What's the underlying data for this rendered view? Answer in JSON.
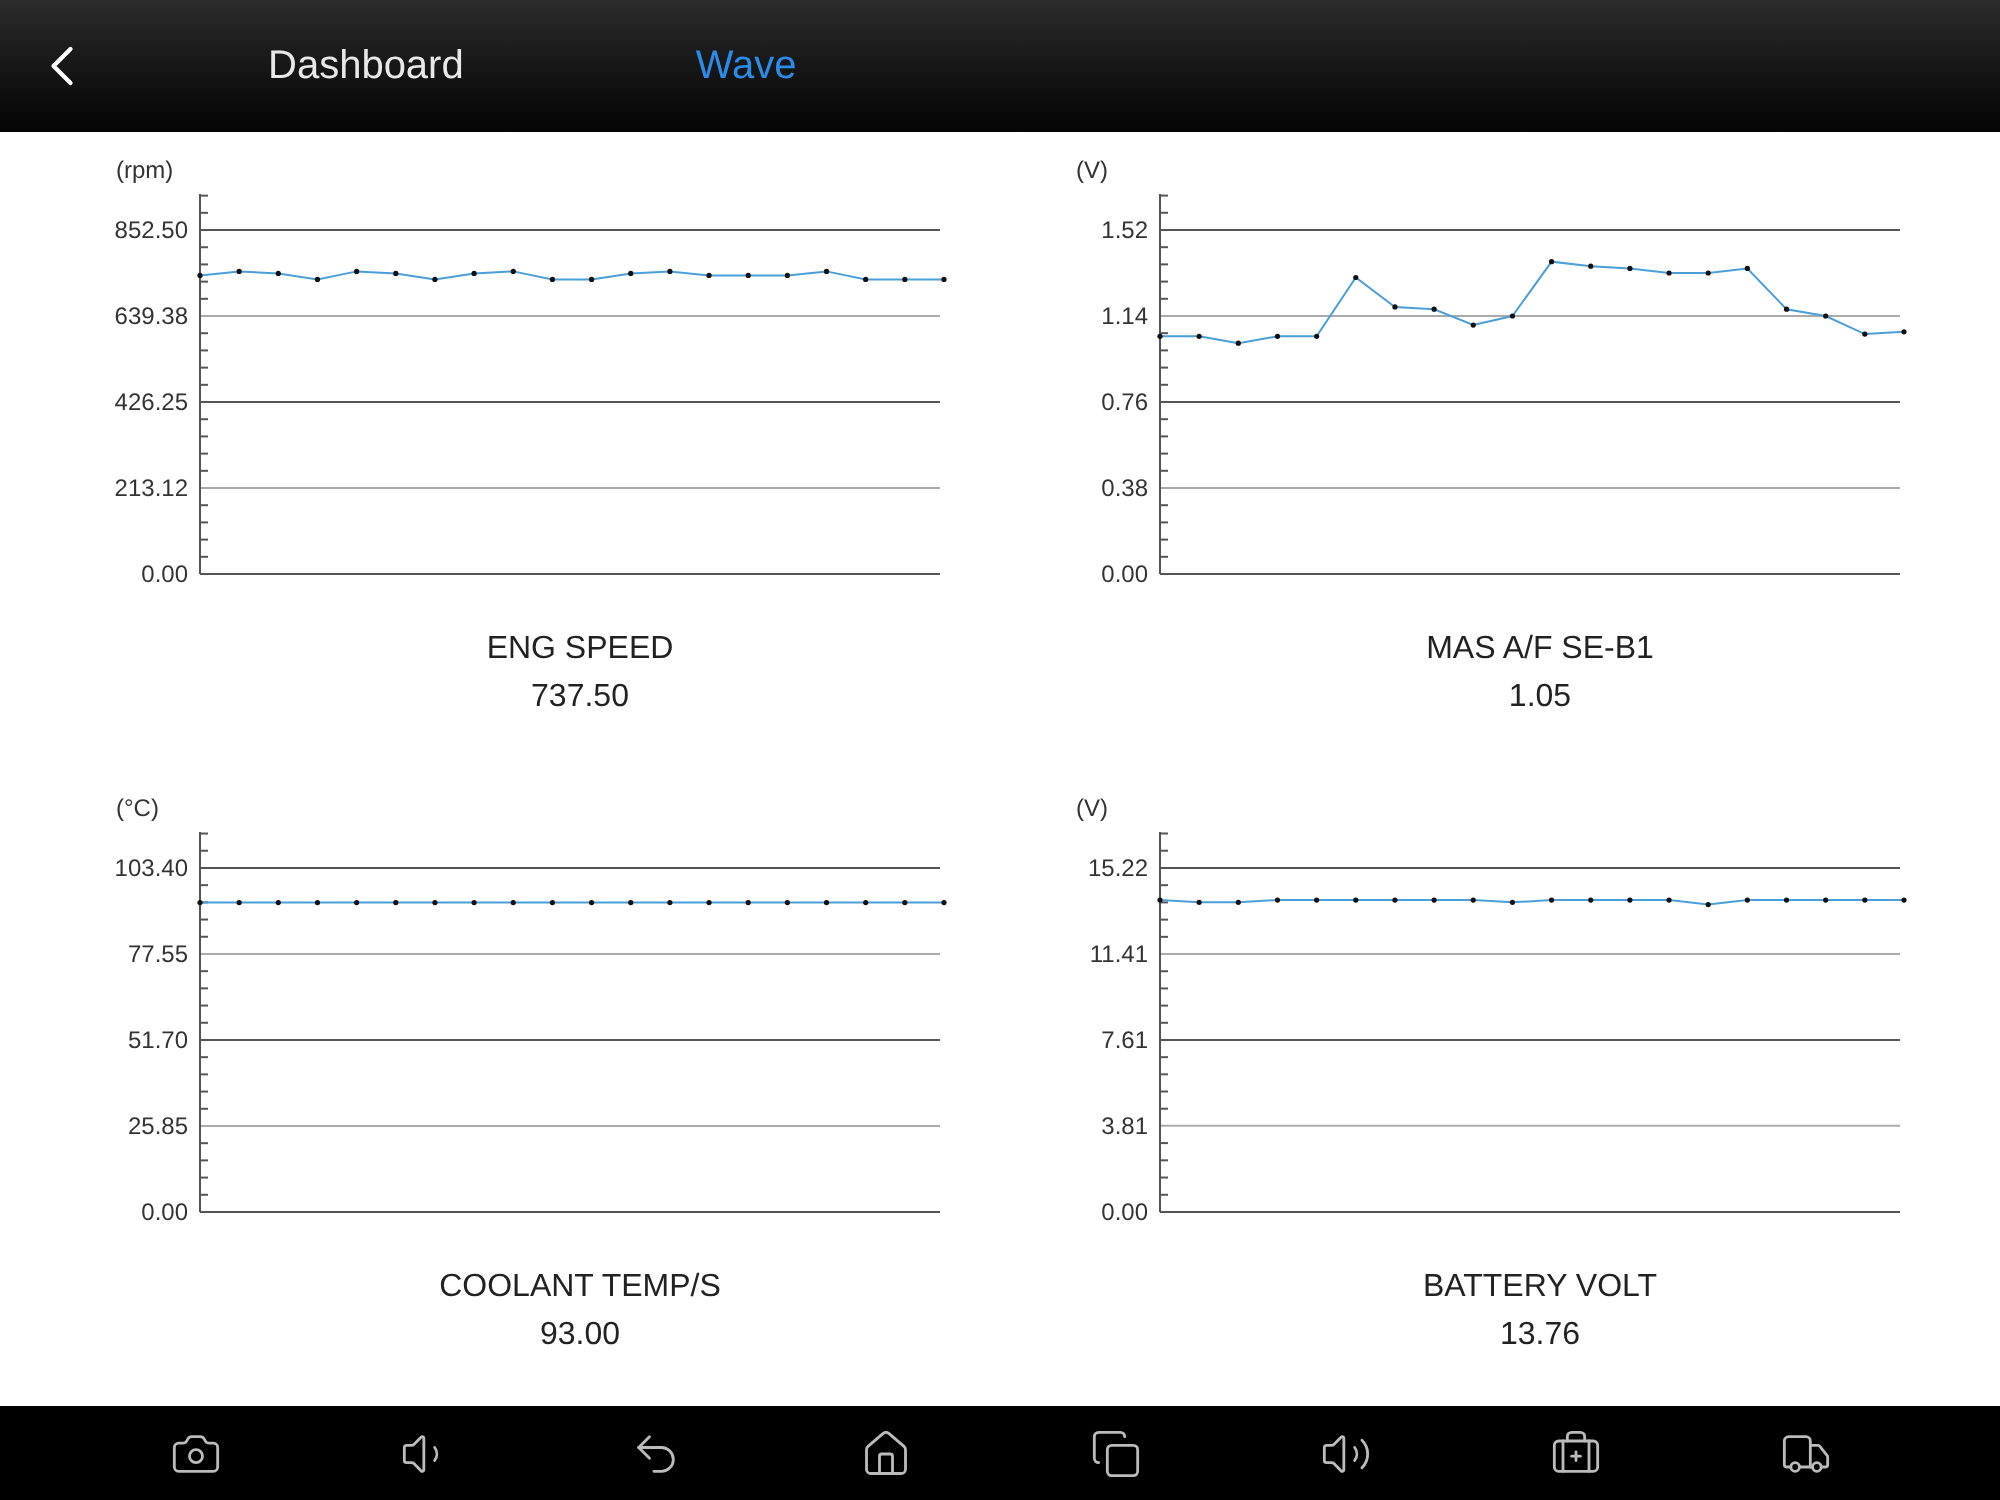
{
  "header": {
    "tabs": [
      {
        "label": "Dashboard",
        "selected": false
      },
      {
        "label": "Wave",
        "selected": true
      }
    ]
  },
  "panels": [
    {
      "name": "ENG SPEED",
      "value": "737.50",
      "chart_data": {
        "type": "line",
        "ylabel": "(rpm)",
        "grid": true,
        "ylim": [
          0,
          941.8
        ],
        "yticks": [
          {
            "value": 0,
            "label": "0.00"
          },
          {
            "value": 213.12,
            "label": "213.12"
          },
          {
            "value": 426.25,
            "label": "426.25"
          },
          {
            "value": 639.38,
            "label": "639.38"
          },
          {
            "value": 852.5,
            "label": "852.50"
          }
        ],
        "series": [
          {
            "color": "#4a9fd8",
            "values": [
              740,
              750,
              745,
              730,
              750,
              745,
              730,
              745,
              750,
              730,
              730,
              745,
              750,
              740,
              740,
              740,
              750,
              730,
              730,
              730
            ]
          }
        ]
      }
    },
    {
      "name": "MAS A/F SE-B1",
      "value": "1.05",
      "chart_data": {
        "type": "line",
        "ylabel": "(V)",
        "grid": true,
        "ylim": [
          0,
          1.679
        ],
        "yticks": [
          {
            "value": 0,
            "label": "0.00"
          },
          {
            "value": 0.38,
            "label": "0.38"
          },
          {
            "value": 0.76,
            "label": "0.76"
          },
          {
            "value": 1.14,
            "label": "1.14"
          },
          {
            "value": 1.52,
            "label": "1.52"
          }
        ],
        "series": [
          {
            "color": "#4a9fd8",
            "values": [
              1.05,
              1.05,
              1.02,
              1.05,
              1.05,
              1.31,
              1.18,
              1.17,
              1.1,
              1.14,
              1.38,
              1.36,
              1.35,
              1.33,
              1.33,
              1.35,
              1.17,
              1.14,
              1.06,
              1.07
            ]
          }
        ]
      }
    },
    {
      "name": "COOLANT TEMP/S",
      "value": "93.00",
      "chart_data": {
        "type": "line",
        "ylabel": "(°C)",
        "grid": true,
        "ylim": [
          0,
          114.2
        ],
        "yticks": [
          {
            "value": 0,
            "label": "0.00"
          },
          {
            "value": 25.85,
            "label": "25.85"
          },
          {
            "value": 51.7,
            "label": "51.70"
          },
          {
            "value": 77.55,
            "label": "77.55"
          },
          {
            "value": 103.4,
            "label": "103.40"
          }
        ],
        "series": [
          {
            "color": "#4a9fd8",
            "values": [
              93,
              93,
              93,
              93,
              93,
              93,
              93,
              93,
              93,
              93,
              93,
              93,
              93,
              93,
              93,
              93,
              93,
              93,
              93,
              93
            ]
          }
        ]
      }
    },
    {
      "name": "BATTERY VOLT",
      "value": "13.76",
      "chart_data": {
        "type": "line",
        "ylabel": "(V)",
        "grid": true,
        "ylim": [
          0,
          16.81
        ],
        "yticks": [
          {
            "value": 0,
            "label": "0.00"
          },
          {
            "value": 3.81,
            "label": "3.81"
          },
          {
            "value": 7.61,
            "label": "7.61"
          },
          {
            "value": 11.41,
            "label": "11.41"
          },
          {
            "value": 15.22,
            "label": "15.22"
          }
        ],
        "series": [
          {
            "color": "#4a9fd8",
            "values": [
              13.8,
              13.7,
              13.7,
              13.8,
              13.8,
              13.8,
              13.8,
              13.8,
              13.8,
              13.7,
              13.8,
              13.8,
              13.8,
              13.8,
              13.6,
              13.8,
              13.8,
              13.8,
              13.8,
              13.8
            ]
          }
        ]
      }
    }
  ]
}
